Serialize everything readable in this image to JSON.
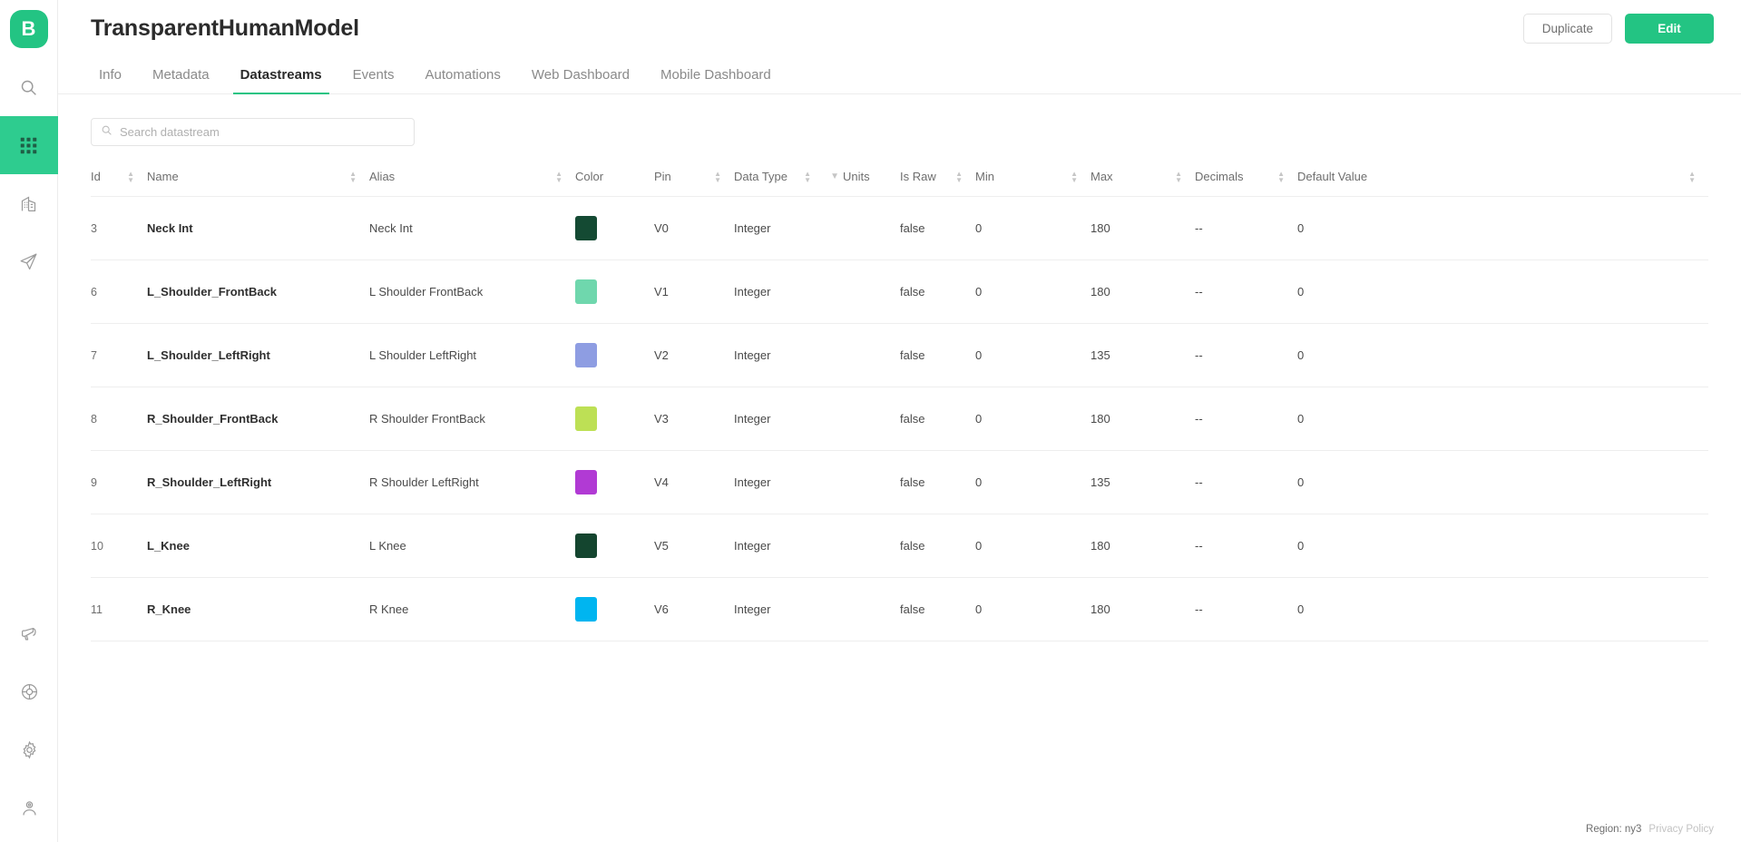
{
  "sidebar": {
    "logo_label": "B",
    "items": [
      {
        "name": "search",
        "icon": "search-icon",
        "active": false
      },
      {
        "name": "apps",
        "icon": "grid-apps-icon",
        "active": true
      },
      {
        "name": "organizations",
        "icon": "building-icon",
        "active": false
      },
      {
        "name": "deploy",
        "icon": "paper-plane-icon",
        "active": false
      }
    ],
    "bottom_items": [
      {
        "name": "announcements",
        "icon": "megaphone-icon",
        "active": false
      },
      {
        "name": "support",
        "icon": "lifebuoy-icon",
        "active": false
      },
      {
        "name": "settings",
        "icon": "gear-icon",
        "active": false
      },
      {
        "name": "account",
        "icon": "user-icon",
        "active": false
      }
    ]
  },
  "header": {
    "title": "TransparentHumanModel",
    "duplicate_label": "Duplicate",
    "edit_label": "Edit"
  },
  "tabs": [
    {
      "label": "Info",
      "active": false
    },
    {
      "label": "Metadata",
      "active": false
    },
    {
      "label": "Datastreams",
      "active": true
    },
    {
      "label": "Events",
      "active": false
    },
    {
      "label": "Automations",
      "active": false
    },
    {
      "label": "Web Dashboard",
      "active": false
    },
    {
      "label": "Mobile Dashboard",
      "active": false
    }
  ],
  "search": {
    "placeholder": "Search datastream",
    "value": "",
    "icon": "search-icon"
  },
  "table": {
    "columns": [
      {
        "key": "id",
        "label": "Id",
        "sortable": true,
        "filterable": false
      },
      {
        "key": "name",
        "label": "Name",
        "sortable": true,
        "filterable": false
      },
      {
        "key": "alias",
        "label": "Alias",
        "sortable": true,
        "filterable": false
      },
      {
        "key": "color",
        "label": "Color",
        "sortable": false,
        "filterable": false
      },
      {
        "key": "pin",
        "label": "Pin",
        "sortable": true,
        "filterable": false
      },
      {
        "key": "data_type",
        "label": "Data Type",
        "sortable": true,
        "filterable": true
      },
      {
        "key": "units",
        "label": "Units",
        "sortable": false,
        "filterable": false
      },
      {
        "key": "is_raw",
        "label": "Is Raw",
        "sortable": true,
        "filterable": false
      },
      {
        "key": "min",
        "label": "Min",
        "sortable": true,
        "filterable": false
      },
      {
        "key": "max",
        "label": "Max",
        "sortable": true,
        "filterable": false
      },
      {
        "key": "decimals",
        "label": "Decimals",
        "sortable": true,
        "filterable": false
      },
      {
        "key": "default_value",
        "label": "Default Value",
        "sortable": true,
        "filterable": false
      }
    ],
    "rows": [
      {
        "id": "3",
        "name": "Neck Int",
        "alias": "Neck Int",
        "color": "#144a33",
        "pin": "V0",
        "data_type": "Integer",
        "units": "",
        "is_raw": "false",
        "min": "0",
        "max": "180",
        "decimals": "--",
        "default_value": "0"
      },
      {
        "id": "6",
        "name": "L_Shoulder_FrontBack",
        "alias": "L Shoulder FrontBack",
        "color": "#6fd7ad",
        "pin": "V1",
        "data_type": "Integer",
        "units": "",
        "is_raw": "false",
        "min": "0",
        "max": "180",
        "decimals": "--",
        "default_value": "0"
      },
      {
        "id": "7",
        "name": "L_Shoulder_LeftRight",
        "alias": "L Shoulder LeftRight",
        "color": "#8e9de2",
        "pin": "V2",
        "data_type": "Integer",
        "units": "",
        "is_raw": "false",
        "min": "0",
        "max": "135",
        "decimals": "--",
        "default_value": "0"
      },
      {
        "id": "8",
        "name": "R_Shoulder_FrontBack",
        "alias": "R Shoulder FrontBack",
        "color": "#bde055",
        "pin": "V3",
        "data_type": "Integer",
        "units": "",
        "is_raw": "false",
        "min": "0",
        "max": "180",
        "decimals": "--",
        "default_value": "0"
      },
      {
        "id": "9",
        "name": "R_Shoulder_LeftRight",
        "alias": "R Shoulder LeftRight",
        "color": "#b13ad4",
        "pin": "V4",
        "data_type": "Integer",
        "units": "",
        "is_raw": "false",
        "min": "0",
        "max": "135",
        "decimals": "--",
        "default_value": "0"
      },
      {
        "id": "10",
        "name": "L_Knee",
        "alias": "L Knee",
        "color": "#14452f",
        "pin": "V5",
        "data_type": "Integer",
        "units": "",
        "is_raw": "false",
        "min": "0",
        "max": "180",
        "decimals": "--",
        "default_value": "0"
      },
      {
        "id": "11",
        "name": "R_Knee",
        "alias": "R Knee",
        "color": "#00b5f0",
        "pin": "V6",
        "data_type": "Integer",
        "units": "",
        "is_raw": "false",
        "min": "0",
        "max": "180",
        "decimals": "--",
        "default_value": "0"
      }
    ]
  },
  "footer": {
    "region": "Region: ny3",
    "privacy": "Privacy Policy"
  },
  "theme": {
    "accent": "#23c483",
    "active_nav": "#2ecc8f",
    "text": "#2b2b2b",
    "muted": "#8a8a8a"
  }
}
